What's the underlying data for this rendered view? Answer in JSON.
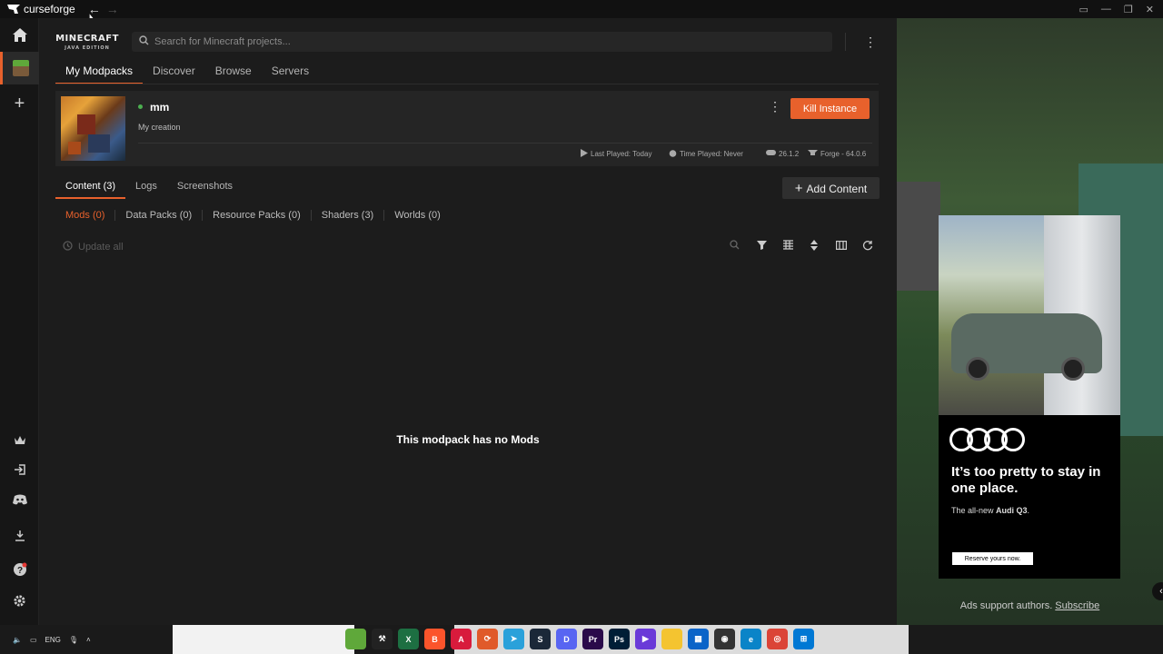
{
  "window": {
    "app_name": "curseforge"
  },
  "header": {
    "game_logo_title": "MINECRAFT",
    "game_logo_sub": "JAVA EDITION",
    "search_placeholder": "Search for Minecraft projects..."
  },
  "top_tabs": [
    {
      "label": "My Modpacks",
      "active": true
    },
    {
      "label": "Discover",
      "active": false
    },
    {
      "label": "Browse",
      "active": false
    },
    {
      "label": "Servers",
      "active": false
    }
  ],
  "instance": {
    "name": "mm",
    "description": "My creation",
    "kill_label": "Kill Instance",
    "last_played": "Last Played: Today",
    "time_played": "Time Played: Never",
    "version": "26.1.2",
    "loader": "Forge - 64.0.6",
    "status_color": "#4caf50"
  },
  "content_tabs": [
    {
      "label": "Content (3)",
      "active": true
    },
    {
      "label": "Logs",
      "active": false
    },
    {
      "label": "Screenshots",
      "active": false
    }
  ],
  "add_content_label": "Add Content",
  "sub_tabs": [
    {
      "label": "Mods (0)",
      "active": true
    },
    {
      "label": "Data Packs (0)",
      "active": false
    },
    {
      "label": "Resource Packs (0)",
      "active": false
    },
    {
      "label": "Shaders (3)",
      "active": false
    },
    {
      "label": "Worlds (0)",
      "active": false
    }
  ],
  "update_all_label": "Update all",
  "empty_message": "This modpack has no Mods",
  "ad": {
    "headline": "It’s too pretty to stay in one place.",
    "subline_prefix": "The all-new ",
    "subline_bold": "Audi Q3",
    "subline_suffix": ".",
    "button_label": "Reserve yours now."
  },
  "ads_note": {
    "text": "Ads support authors.",
    "link": "Subscribe"
  },
  "taskbar": {
    "language": "ENG"
  },
  "colors": {
    "accent": "#e8612c",
    "background": "#1c1c1c"
  }
}
